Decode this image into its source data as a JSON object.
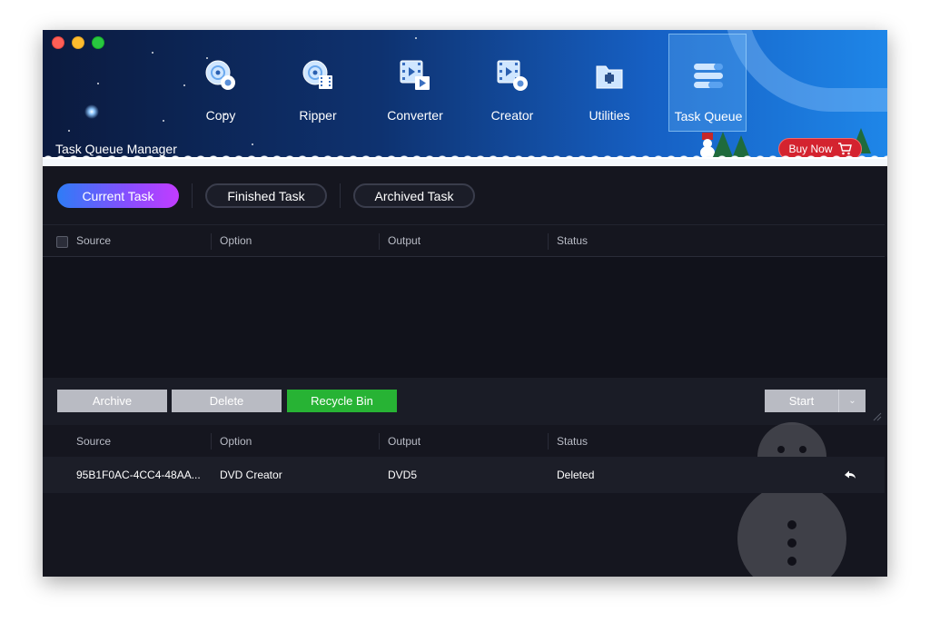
{
  "window": {
    "title": "Task Queue Manager"
  },
  "nav": {
    "items": [
      {
        "label": "Copy",
        "icon": "disc-icon"
      },
      {
        "label": "Ripper",
        "icon": "disc-film-icon"
      },
      {
        "label": "Converter",
        "icon": "film-convert-icon"
      },
      {
        "label": "Creator",
        "icon": "film-disc-icon"
      },
      {
        "label": "Utilities",
        "icon": "toolbox-icon"
      },
      {
        "label": "Task Queue",
        "icon": "queue-icon",
        "active": true
      }
    ],
    "buy_now": "Buy Now"
  },
  "tabs": {
    "current": "Current Task",
    "finished": "Finished Task",
    "archived": "Archived Task"
  },
  "columns": {
    "source": "Source",
    "option": "Option",
    "output": "Output",
    "status": "Status"
  },
  "toolbar": {
    "archive": "Archive",
    "delete": "Delete",
    "recycle_bin": "Recycle Bin",
    "start": "Start",
    "start_arrow": "⌄"
  },
  "recycle_table": {
    "rows": [
      {
        "source": "95B1F0AC-4CC4-48AA...",
        "option": "DVD Creator",
        "output": "DVD5",
        "status": "Deleted"
      }
    ]
  },
  "colors": {
    "accent_gradient_start": "#2e7cf6",
    "accent_gradient_end": "#c23cff",
    "recycle_green": "#27b334",
    "buy_red": "#d4232f",
    "background": "#15161f"
  }
}
